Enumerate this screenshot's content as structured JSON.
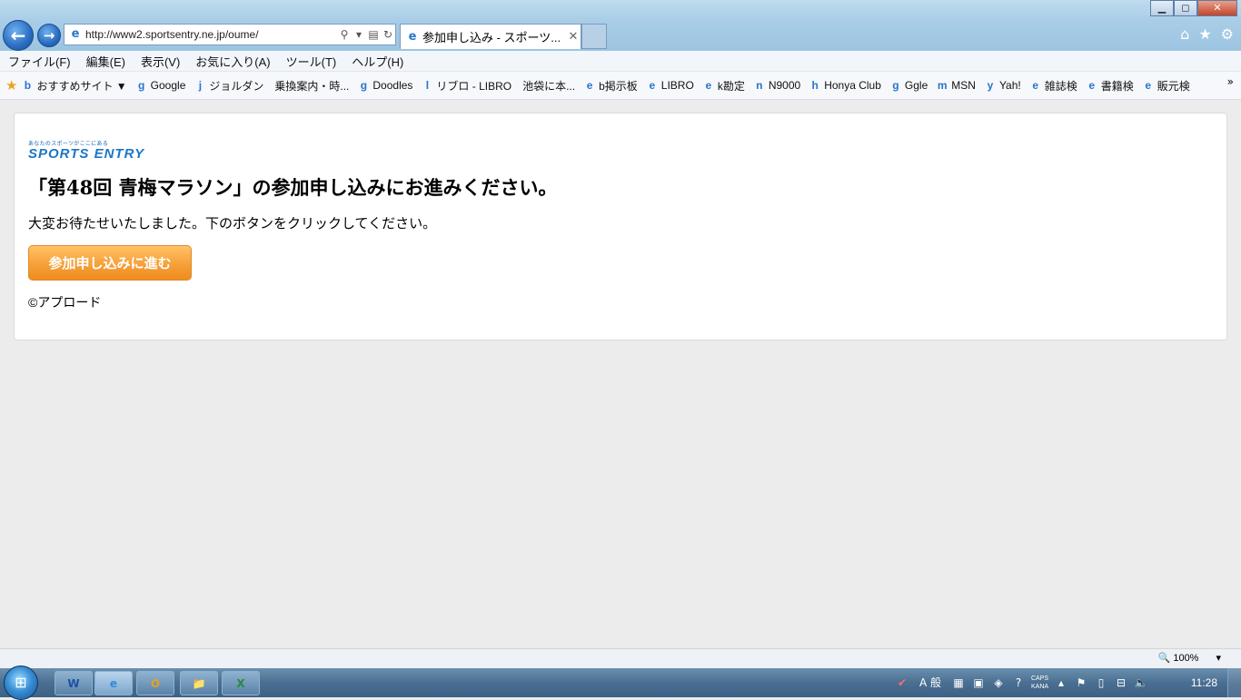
{
  "browser": {
    "url": "http://www2.sportsentry.ne.jp/oume/",
    "tab_title": "参加申し込み - スポーツ...",
    "back_icon": "←",
    "forward_icon": "→",
    "search_icon": "⚲",
    "refresh_icon": "↻",
    "close_tab_icon": "✕",
    "window_controls": {
      "minimize": "▁",
      "maximize": "◻",
      "close": "✕"
    },
    "right_icons": {
      "home": "⌂",
      "favorites": "★",
      "tools": "⚙"
    }
  },
  "menu": [
    "ファイル(F)",
    "編集(E)",
    "表示(V)",
    "お気に入り(A)",
    "ツール(T)",
    "ヘルプ(H)"
  ],
  "favorites": [
    {
      "label": "おすすめサイト ▼",
      "icon": "b"
    },
    {
      "label": "Google",
      "icon": "g"
    },
    {
      "label": "ジョルダン　乗換案内・時...",
      "icon": "j"
    },
    {
      "label": "Doodles",
      "icon": "g"
    },
    {
      "label": "リブロ - LIBRO　池袋に本...",
      "icon": "l"
    },
    {
      "label": "b掲示板",
      "icon": "e"
    },
    {
      "label": "LIBRO",
      "icon": "e"
    },
    {
      "label": "k勘定",
      "icon": "e"
    },
    {
      "label": "N9000",
      "icon": "n"
    },
    {
      "label": "Honya Club",
      "icon": "h"
    },
    {
      "label": "Ggle",
      "icon": "g"
    },
    {
      "label": "MSN",
      "icon": "m"
    },
    {
      "label": "Yah!",
      "icon": "y"
    },
    {
      "label": "雑誌検",
      "icon": "e"
    },
    {
      "label": "書籍検",
      "icon": "e"
    },
    {
      "label": "販元検",
      "icon": "e"
    }
  ],
  "page": {
    "logo_tagline": "あなたのスポーツがここにある",
    "logo_text": "SPORTS ENTRY",
    "headline": "「第48回 青梅マラソン」の参加申し込みにお進みください。",
    "message": "大変お待たせいたしました。下のボタンをクリックしてください。",
    "button_label": "参加申し込みに進む",
    "copyright": "©アプロード"
  },
  "status": {
    "zoom": "100%"
  },
  "taskbar": {
    "apps": [
      "W",
      "e",
      "O",
      "📁",
      "X"
    ],
    "ime": "A 般",
    "caps": "CAPS",
    "kana": "KANA",
    "time": "11:28"
  },
  "colors": {
    "button_top": "#ffc266",
    "button_bottom": "#ef8c1e",
    "logo_blue": "#1b76c6"
  }
}
